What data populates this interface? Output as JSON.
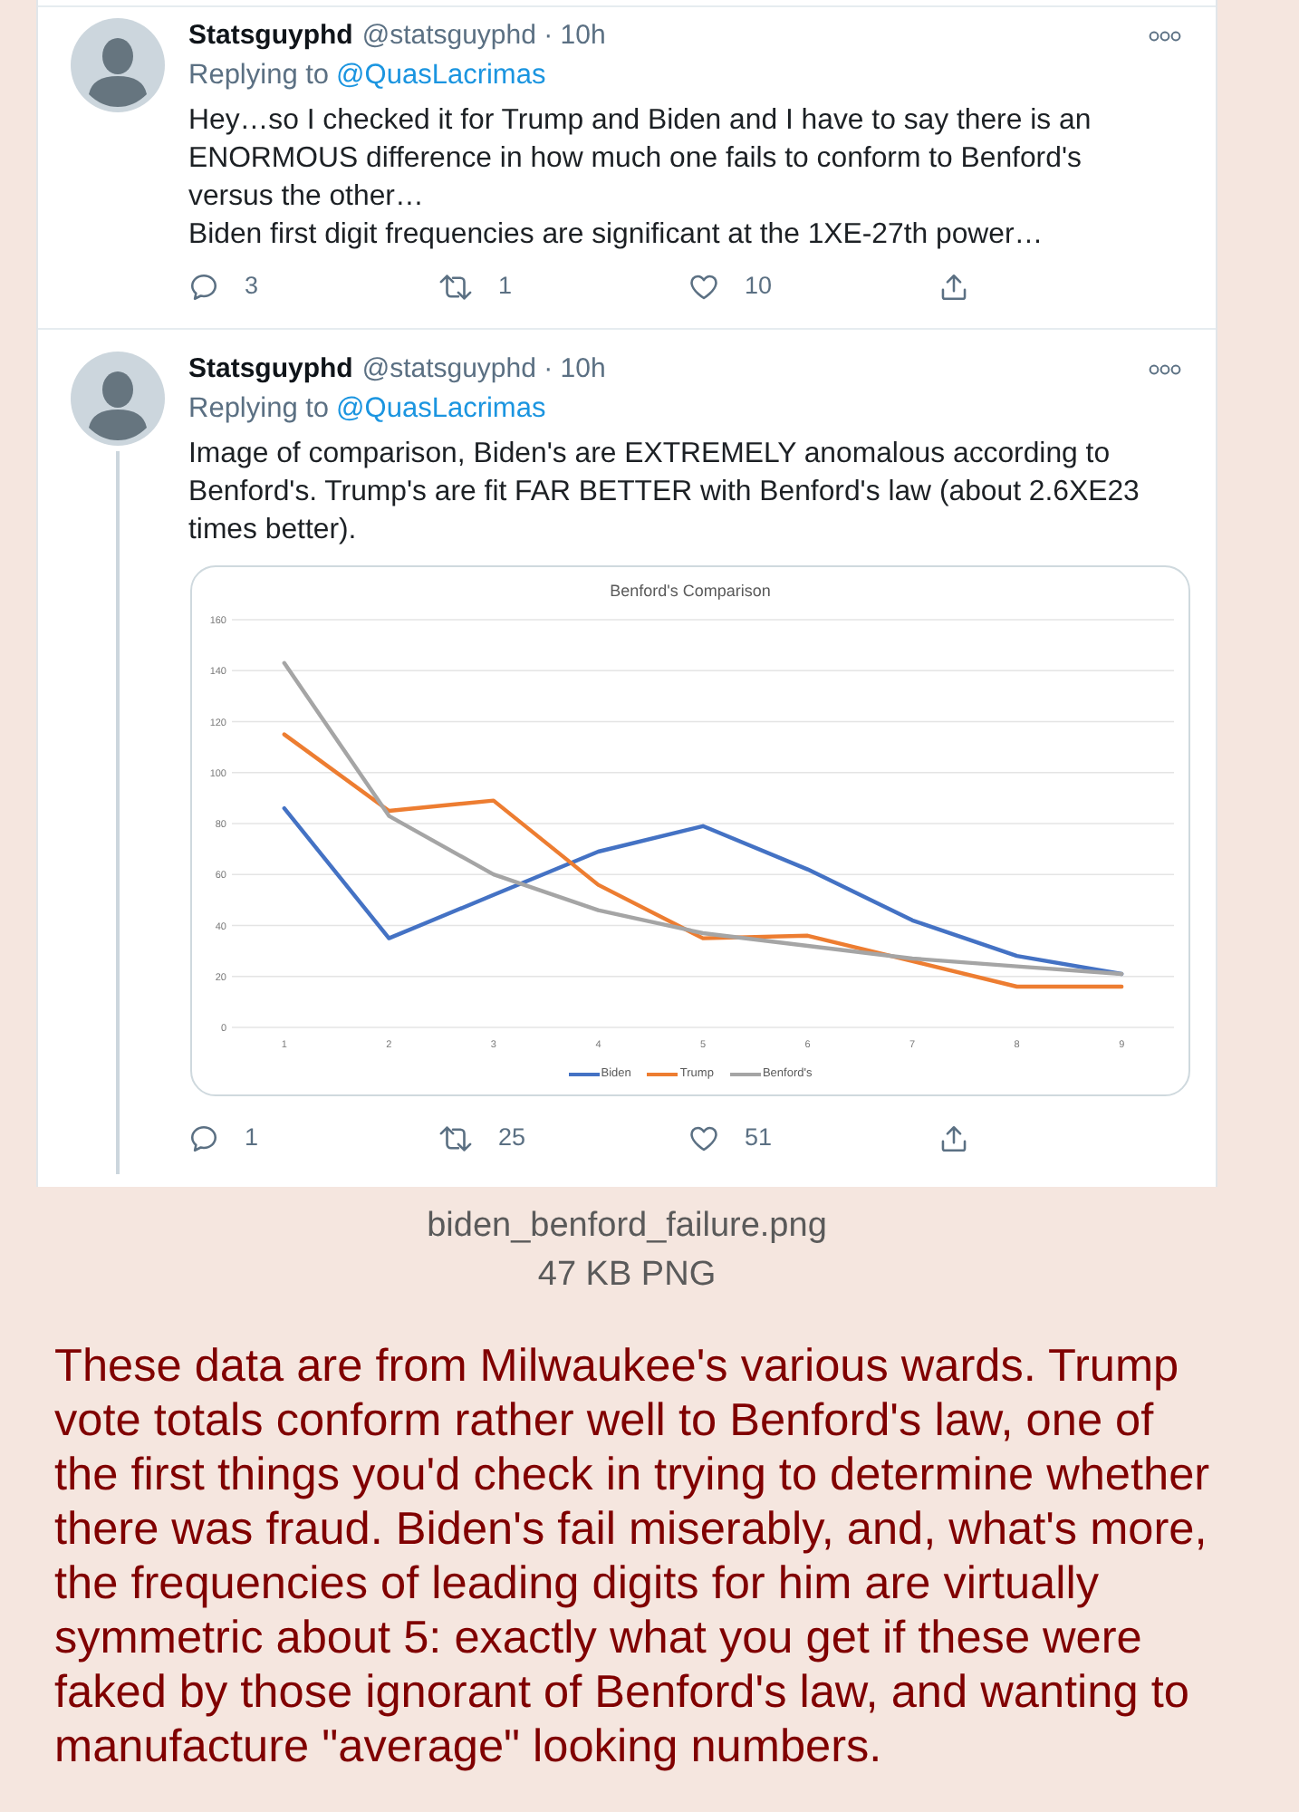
{
  "attachment": {
    "tweets": [
      {
        "author": "Statsguyphd",
        "handle_time": "@statsguyphd · 10h",
        "replying_label": "Replying to",
        "reply_to": "@QuasLacrimas",
        "body": "Hey…so I checked it for Trump and Biden and I have to say there is an ENORMOUS difference in how much one fails to conform to Benford's versus the other…\nBiden first digit frequencies are significant at the 1XE-27th power…",
        "actions": [
          {
            "kind": "reply",
            "count": "3"
          },
          {
            "kind": "retweet",
            "count": "1"
          },
          {
            "kind": "like",
            "count": "10"
          },
          {
            "kind": "share"
          }
        ]
      },
      {
        "author": "Statsguyphd",
        "handle_time": "@statsguyphd · 10h",
        "replying_label": "Replying to",
        "reply_to": "@QuasLacrimas",
        "body": "Image of comparison, Biden's are EXTREMELY anomalous according to Benford's. Trump's are fit FAR BETTER with Benford's law (about 2.6XE23 times better).",
        "thread_line": true,
        "chart_data": {
          "type": "line",
          "title": "Benford's Comparison",
          "categories": [
            "1",
            "2",
            "3",
            "4",
            "5",
            "6",
            "7",
            "8",
            "9"
          ],
          "series": [
            {
              "name": "Biden",
              "color": "#4472c4",
              "values": [
                86,
                35,
                52,
                69,
                79,
                62,
                42,
                28,
                21
              ]
            },
            {
              "name": "Trump",
              "color": "#ed7d31",
              "values": [
                115,
                85,
                89,
                56,
                35,
                36,
                26,
                16,
                16
              ]
            },
            {
              "name": "Benford's",
              "color": "#a5a5a5",
              "values": [
                143,
                83,
                60,
                46,
                37,
                32,
                27,
                24,
                21
              ]
            }
          ],
          "ylim": [
            0,
            160
          ],
          "yticks": [
            0,
            20,
            40,
            60,
            80,
            100,
            120,
            140,
            160
          ],
          "grid": true,
          "legend": true
        },
        "actions": [
          {
            "kind": "reply",
            "count": "1"
          },
          {
            "kind": "retweet",
            "count": "25"
          },
          {
            "kind": "like",
            "count": "51"
          },
          {
            "kind": "share"
          }
        ]
      }
    ],
    "filename": "biden_benford_failure.png",
    "file_info": "47 KB PNG"
  },
  "post_text": "These data are from Milwaukee's various wards. Trump vote totals conform rather well to Benford's law, one of the first things you'd check in trying to determine whether there was fraud. Biden's fail miserably, and, what's more, the frequencies of leading digits for him are virtually symmetric about 5: exactly what you get if these were faked by those ignorant of Benford's law, and wanting to manufacture \"average\" looking numbers."
}
